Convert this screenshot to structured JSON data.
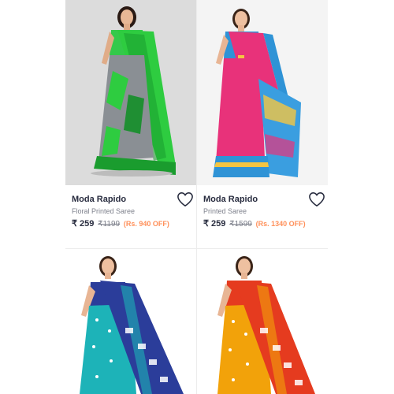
{
  "products": [
    {
      "brand": "Moda Rapido",
      "description": "Floral Printed Saree",
      "price": "₹ 259",
      "mrp": "₹1199",
      "discount": "(Rs. 940 OFF)",
      "wishlist_icon": "heart-outline-icon",
      "colors": {
        "bg": "#dcdcdc",
        "saree": "#2ecc40",
        "accent": "#8a8f94"
      }
    },
    {
      "brand": "Moda Rapido",
      "description": "Printed Saree",
      "price": "₹ 259",
      "mrp": "₹1599",
      "discount": "(Rs. 1340 OFF)",
      "wishlist_icon": "heart-outline-icon",
      "colors": {
        "bg": "#f4f4f4",
        "saree": "#e8327a",
        "accent": "#2f93d6"
      }
    },
    {
      "colors": {
        "bg": "#ffffff",
        "saree": "#1db3b8",
        "accent": "#2b3d9a"
      }
    },
    {
      "colors": {
        "bg": "#ffffff",
        "saree": "#f2a20a",
        "accent": "#e53b1f"
      }
    }
  ]
}
